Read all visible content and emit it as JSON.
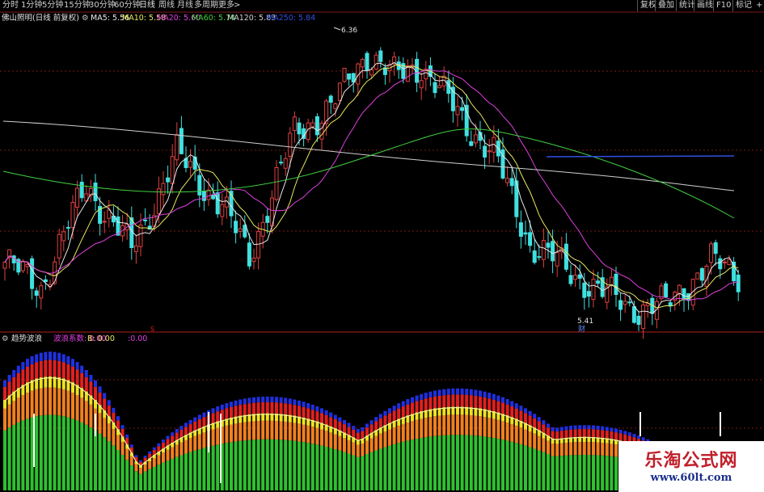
{
  "toolbar": {
    "periods": [
      {
        "label": "分时",
        "active": false
      },
      {
        "label": "1分钟",
        "active": false
      },
      {
        "label": "5分钟",
        "active": false
      },
      {
        "label": "15分钟",
        "active": false
      },
      {
        "label": "30分钟",
        "active": false
      },
      {
        "label": "60分钟",
        "active": false
      },
      {
        "label": "日线",
        "active": true
      },
      {
        "label": "周线",
        "active": false
      },
      {
        "label": "月线",
        "active": false
      },
      {
        "label": "多周期",
        "active": false
      },
      {
        "label": "更多",
        "active": false
      }
    ],
    "more_arrow": ">",
    "right_buttons": [
      "复权",
      "叠加",
      "统计",
      "画线",
      "F10",
      "标记"
    ],
    "extra_icon": "+"
  },
  "main_chart": {
    "stock_title": "佛山照明(日线 前复权)",
    "ma_labels": [
      {
        "text": "MA5: 5.56",
        "color": "#e8e8e8"
      },
      {
        "text": "MA10: 5.58",
        "color": "#e8e860"
      },
      {
        "text": "MA20: 5.60",
        "color": "#e040e0"
      },
      {
        "text": "MA60: 5.74",
        "color": "#40d040"
      },
      {
        "text": "MA120: 5.83",
        "color": "#d0d0d0"
      },
      {
        "text": "MA250: 5.84",
        "color": "#3050e0"
      }
    ],
    "high_marker": "6.36",
    "low_marker": "5.41",
    "event_marker": "财",
    "s_marker": "S",
    "colors": {
      "up": "#e04040",
      "down": "#40e0e0",
      "ma5": "#e8e8e8",
      "ma10": "#e8e860",
      "ma20": "#e040e0",
      "ma60": "#40d040",
      "ma120": "#d0d0d0",
      "ma250": "#3050e0",
      "grid": "#7a1a1a"
    }
  },
  "sub_chart": {
    "indicator_name": "趋势波浪",
    "coef_label": "波浪系数: 0.00",
    "b_label": "B: 0.00",
    "extra_value": ":0.00",
    "colors": {
      "green": "#30c030",
      "orange": "#f08020",
      "yellow": "#f0e020",
      "red": "#e02020",
      "blue": "#2030e0",
      "cyan": "#40c0e0",
      "signal": "#ffffff",
      "line": "#f0f0a0"
    }
  },
  "watermark": {
    "name": "乐淘公式网",
    "url": "www.60lt.com"
  }
}
